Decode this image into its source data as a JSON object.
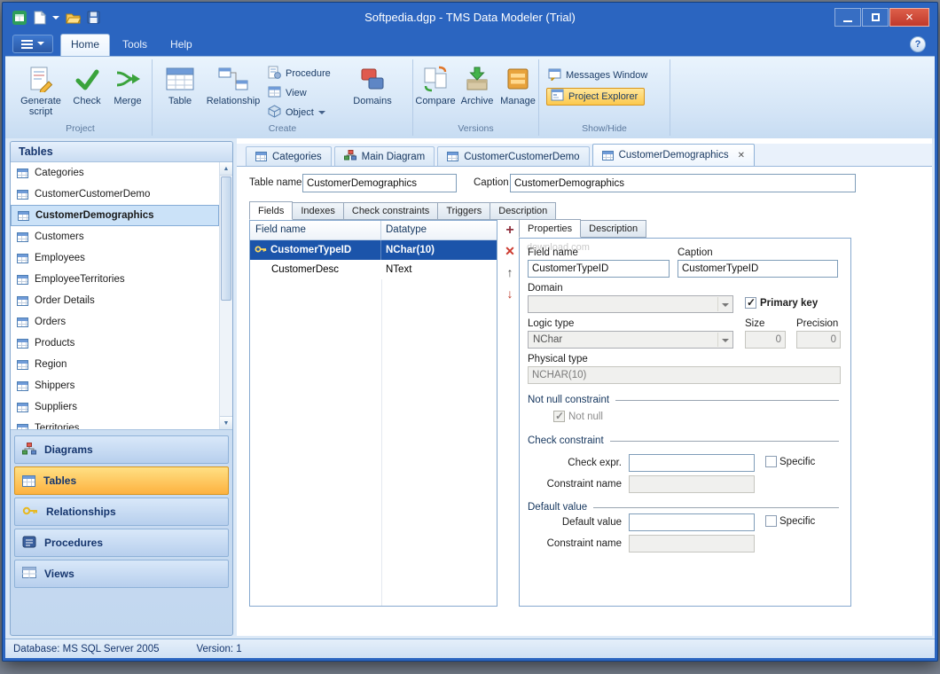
{
  "window": {
    "title": "Softpedia.dgp - TMS Data Modeler (Trial)"
  },
  "icons": {
    "close_window": "×",
    "help": "?",
    "close_tab": "✕",
    "add_field": "+",
    "delete_field": "✕",
    "move_field_up": "↑",
    "move_field_down": "↓",
    "scroll_up": "▲",
    "scroll_down": "▼"
  },
  "ribbon": {
    "tabs": [
      "Home",
      "Tools",
      "Help"
    ],
    "active_tab": "Home",
    "project": {
      "label": "Project",
      "generate_script": "Generate script",
      "check": "Check",
      "merge": "Merge"
    },
    "create": {
      "label": "Create",
      "table": "Table",
      "relationship": "Relationship",
      "procedure": "Procedure",
      "view": "View",
      "object": "Object",
      "domains": "Domains"
    },
    "versions": {
      "label": "Versions",
      "compare": "Compare",
      "archive": "Archive",
      "manage": "Manage"
    },
    "show_hide": {
      "label": "Show/Hide",
      "messages_window": "Messages Window",
      "project_explorer": "Project Explorer"
    }
  },
  "sidebar": {
    "header": "Tables",
    "tables": [
      "Categories",
      "CustomerCustomerDemo",
      "CustomerDemographics",
      "Customers",
      "Employees",
      "EmployeeTerritories",
      "Order Details",
      "Orders",
      "Products",
      "Region",
      "Shippers",
      "Suppliers",
      "Territories"
    ],
    "selected_table": "CustomerDemographics",
    "nav": [
      "Diagrams",
      "Tables",
      "Relationships",
      "Procedures",
      "Views"
    ],
    "active_nav": "Tables"
  },
  "document": {
    "tabs": [
      "Categories",
      "Main Diagram",
      "CustomerCustomerDemo",
      "CustomerDemographics"
    ],
    "active_doc_tab": "CustomerDemographics",
    "table_name_label": "Table name",
    "table_name": "CustomerDemographics",
    "caption_label": "Caption",
    "caption": "CustomerDemographics",
    "subtabs": [
      "Fields",
      "Indexes",
      "Check constraints",
      "Triggers",
      "Description"
    ],
    "active_subtab": "Fields"
  },
  "fields_grid": {
    "columns": [
      "Field name",
      "Datatype"
    ],
    "rows": [
      {
        "name": "CustomerTypeID",
        "datatype": "NChar(10)",
        "primary_key": true,
        "selected": true
      },
      {
        "name": "CustomerDesc",
        "datatype": "NText",
        "primary_key": false,
        "selected": false
      }
    ]
  },
  "properties": {
    "tabs": [
      "Properties",
      "Description"
    ],
    "active_tab": "Properties",
    "watermark": "download.com",
    "field_name_label": "Field name",
    "field_name": "CustomerTypeID",
    "caption_label": "Caption",
    "caption": "CustomerTypeID",
    "domain_label": "Domain",
    "domain_value": "",
    "primary_key_label": "Primary key",
    "primary_key_checked": true,
    "logic_type_label": "Logic type",
    "logic_type": "NChar",
    "size_label": "Size",
    "size_value": "0",
    "precision_label": "Precision",
    "precision_value": "0",
    "physical_type_label": "Physical type",
    "physical_type": "NCHAR(10)",
    "not_null_section": "Not null constraint",
    "not_null_label": "Not null",
    "not_null_checked": true,
    "check_section": "Check constraint",
    "check_expr_label": "Check expr.",
    "check_expr_value": "",
    "check_specific_label": "Specific",
    "check_constraint_name_label": "Constraint name",
    "check_constraint_name_value": "",
    "default_section": "Default value",
    "default_value_label": "Default value",
    "default_value": "",
    "default_specific_label": "Specific",
    "default_constraint_name_label": "Constraint name",
    "default_constraint_name_value": ""
  },
  "statusbar": {
    "database": "Database: MS SQL Server 2005",
    "version": "Version: 1"
  }
}
